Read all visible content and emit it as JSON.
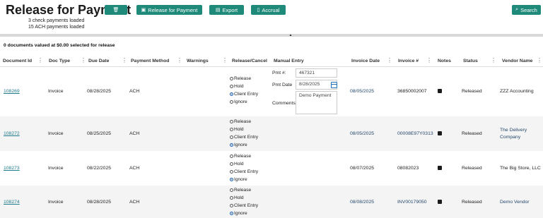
{
  "page_title": "Release for Payment",
  "toolbar": {
    "delete_icon": "trash-icon",
    "release_label": "Release for Payment",
    "export_label": "Export",
    "accrual_label": "Accrual",
    "search_label": "Search"
  },
  "loaded": {
    "checks": "3 check payments loaded",
    "ach": "15 ACH payments loaded"
  },
  "summary": "0 documents valued at $0.00 selected for release",
  "columns": {
    "document_id": "Document Id",
    "doc_type": "Doc Type",
    "due_date": "Due Date",
    "payment_method": "Payment Method",
    "warnings": "Warnings",
    "release_cancel": "Release/Cancel",
    "manual_entry": "Manual Entry",
    "invoice_date": "Invoice Date",
    "invoice_no": "Invoice #",
    "notes": "Notes",
    "status": "Status",
    "vendor_name": "Vendor Name"
  },
  "radio_labels": {
    "release": "Release",
    "hold": "Hold",
    "client_entry": "Client Entry",
    "ignore": "Ignore"
  },
  "manual_entry": {
    "pmt_no_label": "Pmt #:",
    "pmt_no_value": "467321",
    "pmt_date_label": "Pmt Date",
    "pmt_date_value": "8/28/2025",
    "comments_label": "Comments",
    "comments_value": "Demo Payment"
  },
  "rows": [
    {
      "document_id": "108269",
      "doc_type": "Invoice",
      "due_date": "08/28/2025",
      "payment_method": "ACH",
      "selected": "Client Entry",
      "invoice_date": "08/05/2025",
      "invoice_no": "36850002007",
      "status": "Released",
      "vendor_line1": "ZZZ Accounting",
      "vendor_line2": ""
    },
    {
      "document_id": "108272",
      "doc_type": "Invoice",
      "due_date": "08/25/2025",
      "payment_method": "ACH",
      "selected": "Ignore",
      "invoice_date": "08/05/2025",
      "invoice_no": "00008E97Y0313",
      "status": "Released",
      "vendor_line1": "The Delivery",
      "vendor_line2": "Company"
    },
    {
      "document_id": "108273",
      "doc_type": "Invoice",
      "due_date": "08/22/2025",
      "payment_method": "ACH",
      "selected": "Ignore",
      "invoice_date": "08/07/2025",
      "invoice_no": "08082023",
      "status": "Released",
      "vendor_line1": "The Big Store, LLC",
      "vendor_line2": ""
    },
    {
      "document_id": "108274",
      "doc_type": "Invoice",
      "due_date": "08/28/2025",
      "payment_method": "ACH",
      "selected": "Ignore",
      "invoice_date": "08/08/2025",
      "invoice_no": "INV00179050",
      "status": "Released",
      "vendor_line1": "Demo Vendor",
      "vendor_line2": ""
    }
  ]
}
